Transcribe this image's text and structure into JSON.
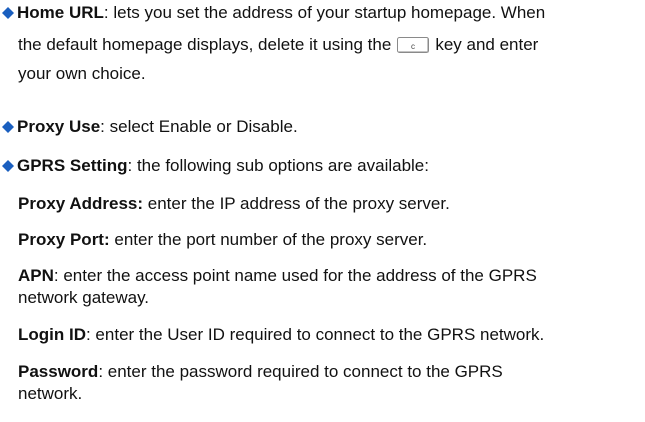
{
  "colors": {
    "bullet": "#1a5fbf",
    "text": "#111111",
    "key_border": "#8a8a8a"
  },
  "icons": {
    "bullet": "diamond-bullet-icon",
    "key": "c-key-icon"
  },
  "items": [
    {
      "term": "Home URL",
      "desc_a": ": lets you set the address of your startup homepage. When",
      "desc_b": "the default homepage displays, delete it using the",
      "key_label": "c",
      "desc_c": "key and enter",
      "desc_d": "your own choice."
    },
    {
      "term": "Proxy Use",
      "desc": ": select Enable or Disable."
    },
    {
      "term": "GPRS Setting",
      "desc": ": the following sub options are available:"
    }
  ],
  "sub_options": [
    {
      "term": "Proxy Address:",
      "desc": " enter the IP address of the proxy server."
    },
    {
      "term": "Proxy Port:",
      "desc": " enter the port number of the proxy server."
    },
    {
      "term": "APN",
      "desc": ": enter the access point name used for the address of the GPRS",
      "desc2": "network gateway."
    },
    {
      "term": "Login ID",
      "desc": ": enter the User ID required to connect to the GPRS network."
    },
    {
      "term": "Password",
      "desc": ": enter the password required to connect to the GPRS",
      "desc2": "network."
    }
  ]
}
